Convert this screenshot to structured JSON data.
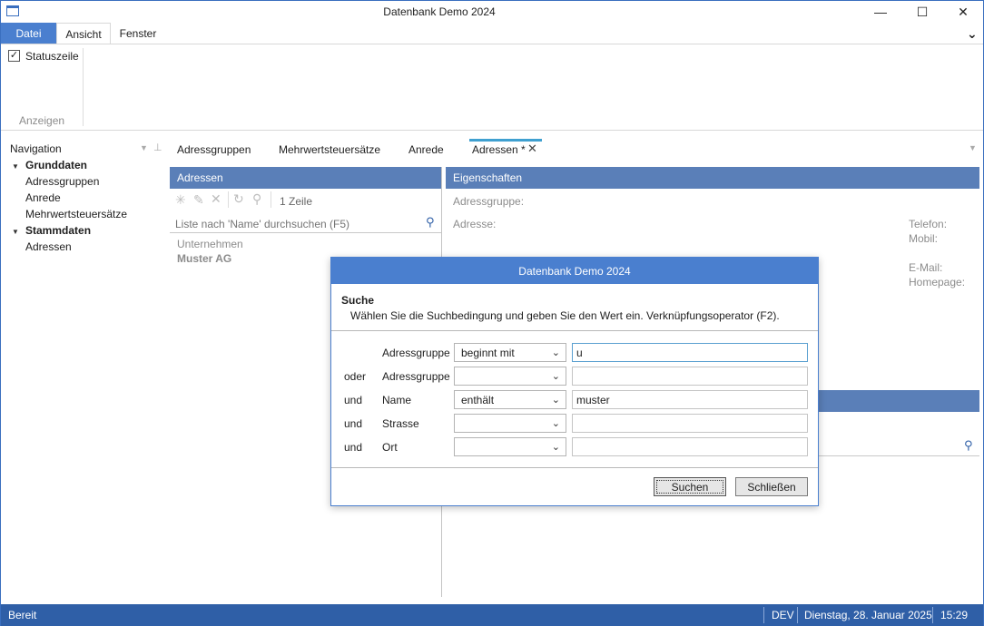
{
  "window": {
    "title": "Datenbank Demo 2024"
  },
  "ribbon": {
    "tabs": {
      "file": "Datei",
      "view": "Ansicht",
      "window": "Fenster"
    },
    "statusline_checkbox": "Statuszeile",
    "group_label": "Anzeigen"
  },
  "navigation": {
    "title": "Navigation",
    "groups": [
      {
        "label": "Grunddaten",
        "items": [
          "Adressgruppen",
          "Anrede",
          "Mehrwertsteuersätze"
        ]
      },
      {
        "label": "Stammdaten",
        "items": [
          "Adressen"
        ]
      }
    ]
  },
  "doc_tabs": [
    "Adressgruppen",
    "Mehrwertsteuersätze",
    "Anrede",
    "Adressen *"
  ],
  "list_pane": {
    "title": "Adressen",
    "row_count": "1 Zeile",
    "search_placeholder": "Liste nach 'Name' durchsuchen (F5)",
    "items": [
      {
        "group": "Unternehmen",
        "name": "Muster AG"
      }
    ]
  },
  "properties_pane": {
    "title": "Eigenschaften",
    "address_group_label": "Adressgruppe:",
    "address_label": "Adresse:",
    "phone_label": "Telefon:",
    "mobile_label": "Mobil:",
    "email_label": "E-Mail:",
    "homepage_label": "Homepage:"
  },
  "dialog": {
    "title": "Datenbank Demo 2024",
    "heading": "Suche",
    "description": "Wählen Sie die Suchbedingung und geben Sie den Wert ein. Verknüpfungsoperator (F2).",
    "rows": [
      {
        "operator": "",
        "field": "Adressgruppe",
        "condition": "beginnt mit",
        "value": "u"
      },
      {
        "operator": "oder",
        "field": "Adressgruppe",
        "condition": "",
        "value": ""
      },
      {
        "operator": "und",
        "field": "Name",
        "condition": "enthält",
        "value": "muster"
      },
      {
        "operator": "und",
        "field": "Strasse",
        "condition": "",
        "value": ""
      },
      {
        "operator": "und",
        "field": "Ort",
        "condition": "",
        "value": ""
      }
    ],
    "search_button": "Suchen",
    "close_button": "Schließen"
  },
  "status_bar": {
    "status": "Bereit",
    "environment": "DEV",
    "date": "Dienstag, 28. Januar 2025",
    "time": "15:29"
  }
}
